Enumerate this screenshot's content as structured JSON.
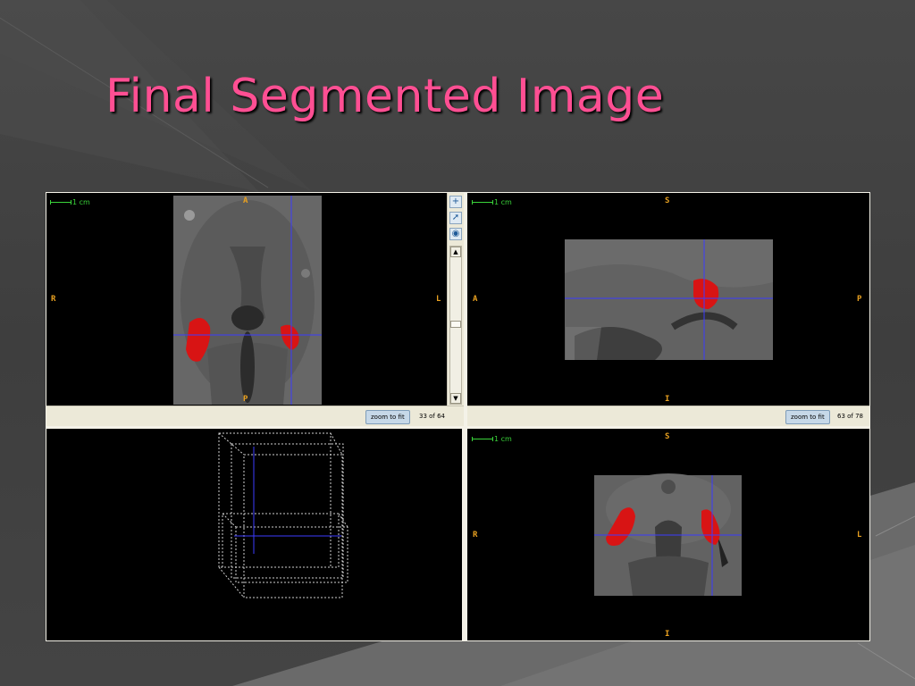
{
  "slide": {
    "title": "Final Segmented Image",
    "accent_color": "#ff4f93",
    "background_color": "#3a3a3a"
  },
  "viewer": {
    "scale_label": "1 cm",
    "segmentation_color": "#d81414",
    "crosshair_color": "#3b3bff",
    "orientation_color": "#e8a020",
    "panes": {
      "axial": {
        "top": "A",
        "bottom": "P",
        "left": "R",
        "right": "L",
        "zoom_button": "zoom to fit",
        "slice_counter": "33 of 64"
      },
      "sagittal": {
        "top": "S",
        "bottom": "I",
        "left": "A",
        "right": "P",
        "zoom_button": "zoom to fit",
        "slice_counter": "63 of 78"
      },
      "coronal": {
        "top": "S",
        "bottom": "I",
        "left": "R",
        "right": "L"
      }
    },
    "side_tools": [
      "plus-icon",
      "pointer-icon",
      "camera-icon"
    ]
  }
}
